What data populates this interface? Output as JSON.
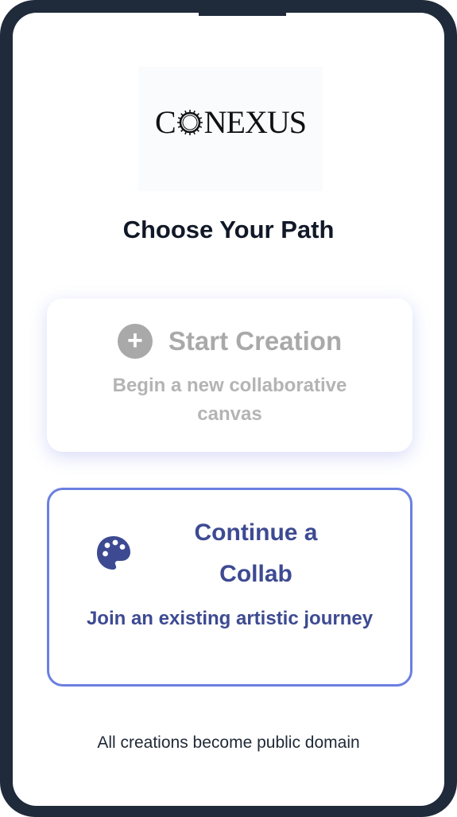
{
  "logo": {
    "text_before": "C",
    "text_after": "NEXUS"
  },
  "page_title": "Choose Your Path",
  "start_card": {
    "icon": "plus-circle-icon",
    "title": "Start Creation",
    "subtitle": "Begin a new collaborative canvas"
  },
  "collab_card": {
    "icon": "palette-icon",
    "title": "Continue a Collab",
    "subtitle": "Join an existing artistic journey"
  },
  "footer_text": "All creations become public domain",
  "colors": {
    "frame": "#1f2a3a",
    "accent": "#6b7fe0",
    "accent_text": "#3d4a92",
    "disabled": "#a9a9a9"
  }
}
